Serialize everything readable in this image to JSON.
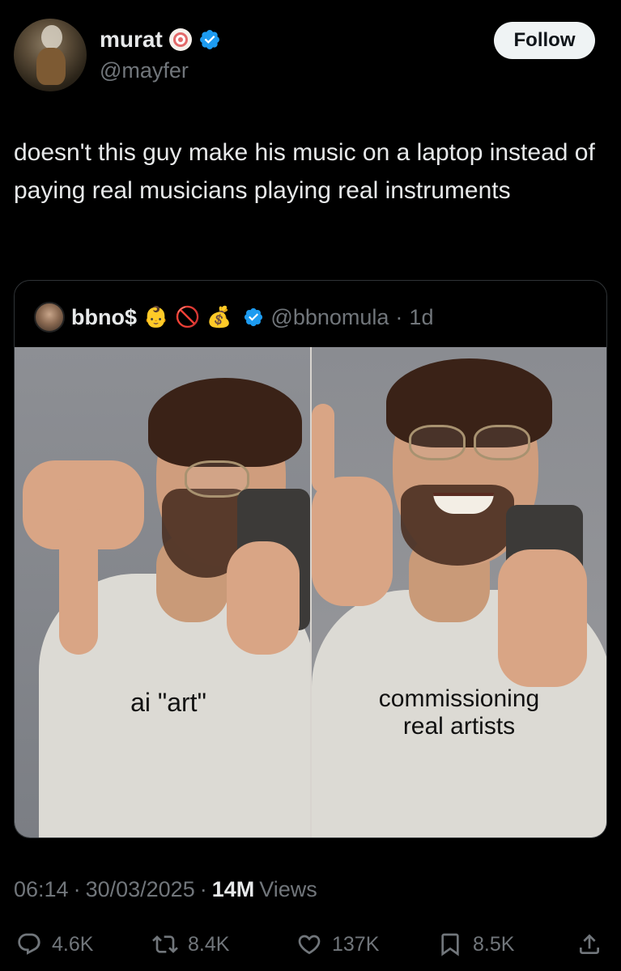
{
  "author": {
    "display_name": "murat",
    "handle": "@mayfer",
    "verified": true,
    "badge_icon": "spiral-emoji-icon"
  },
  "follow_label": "Follow",
  "tweet_text": "doesn't this guy make his music on a laptop instead of paying real musicians playing real instruments",
  "quoted": {
    "display_name": "bbno$",
    "emojis": [
      "👶",
      "🚫",
      "💰"
    ],
    "verified": true,
    "handle": "@bbnomula",
    "separator": "·",
    "age": "1d",
    "media": {
      "left_caption": "ai \"art\"",
      "right_caption_line1": "commissioning",
      "right_caption_line2": "real artists"
    }
  },
  "meta": {
    "time": "06:14",
    "sep1": "·",
    "date": "30/03/2025",
    "sep2": "·",
    "views_count": "14M",
    "views_label": "Views"
  },
  "actions": {
    "replies": "4.6K",
    "reposts": "8.4K",
    "likes": "137K",
    "bookmarks": "8.5K"
  },
  "colors": {
    "background": "#000000",
    "text": "#e7e9ea",
    "secondary": "#71767b",
    "verified": "#1d9bf0",
    "border": "#2f3336"
  }
}
